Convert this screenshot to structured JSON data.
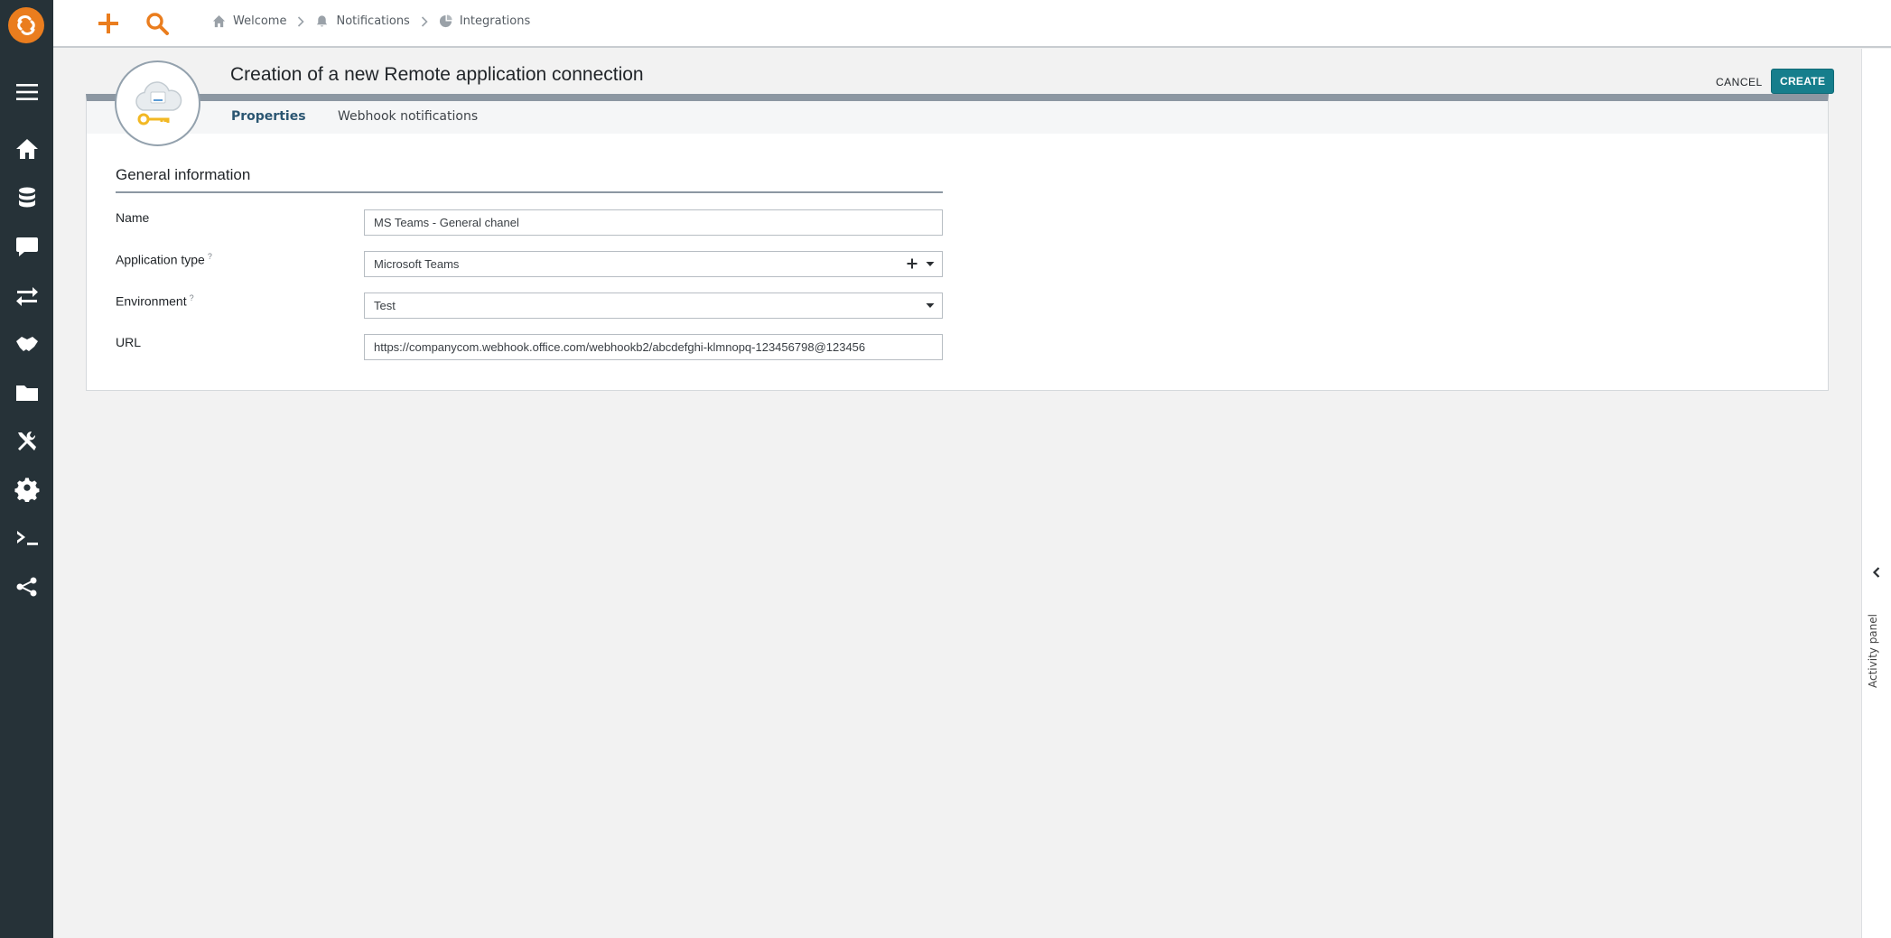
{
  "breadcrumb": {
    "items": [
      "Welcome",
      "Notifications",
      "Integrations"
    ]
  },
  "page": {
    "title": "Creation of a new Remote application connection"
  },
  "actions": {
    "cancel": "CANCEL",
    "create": "CREATE"
  },
  "tabs": [
    "Properties",
    "Webhook notifications"
  ],
  "section": {
    "title": "General information"
  },
  "form": {
    "name": {
      "label": "Name",
      "value": "MS Teams - General chanel"
    },
    "application_type": {
      "label": "Application type",
      "hint": "?",
      "value": "Microsoft Teams"
    },
    "environment": {
      "label": "Environment",
      "hint": "?",
      "value": "Test"
    },
    "url": {
      "label": "URL",
      "value": "https://companycom.webhook.office.com/webhookb2/abcdefghi-klmnopq-123456798@123456"
    }
  },
  "activity_panel": {
    "label": "Activity panel"
  },
  "colors": {
    "sidebar": "#263238",
    "accent_orange": "#ea7d1e",
    "primary_button": "#167e8c"
  },
  "icons": {
    "sidebar": [
      "menu-icon",
      "home-icon",
      "database-icon",
      "chat-icon",
      "exchange-icon",
      "handshake-icon",
      "folder-icon",
      "tools-icon",
      "gear-icon",
      "terminal-icon",
      "share-icon"
    ]
  }
}
